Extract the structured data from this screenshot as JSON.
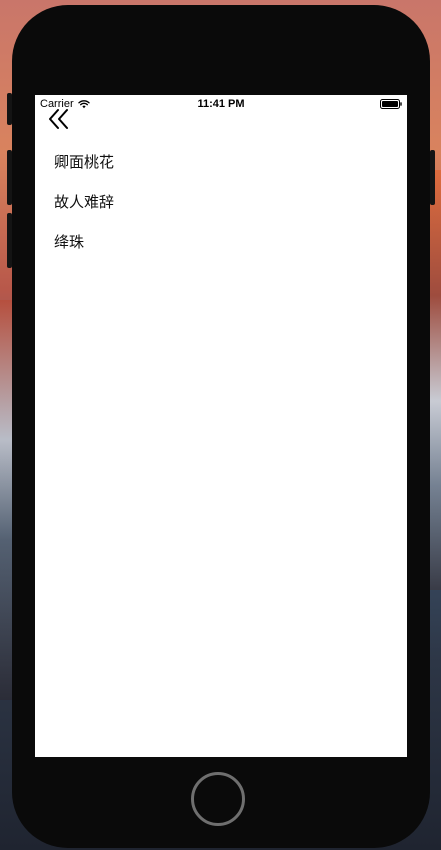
{
  "status_bar": {
    "carrier": "Carrier",
    "time": "11:41 PM",
    "wifi_icon": "wifi-icon",
    "battery_icon": "battery-icon"
  },
  "nav": {
    "back_icon": "double-chevron-left-icon"
  },
  "list": {
    "items": [
      {
        "label": "卿面桃花"
      },
      {
        "label": "故人难辞"
      },
      {
        "label": "绛珠"
      }
    ]
  },
  "device": {
    "home_button_icon": "home-button"
  }
}
